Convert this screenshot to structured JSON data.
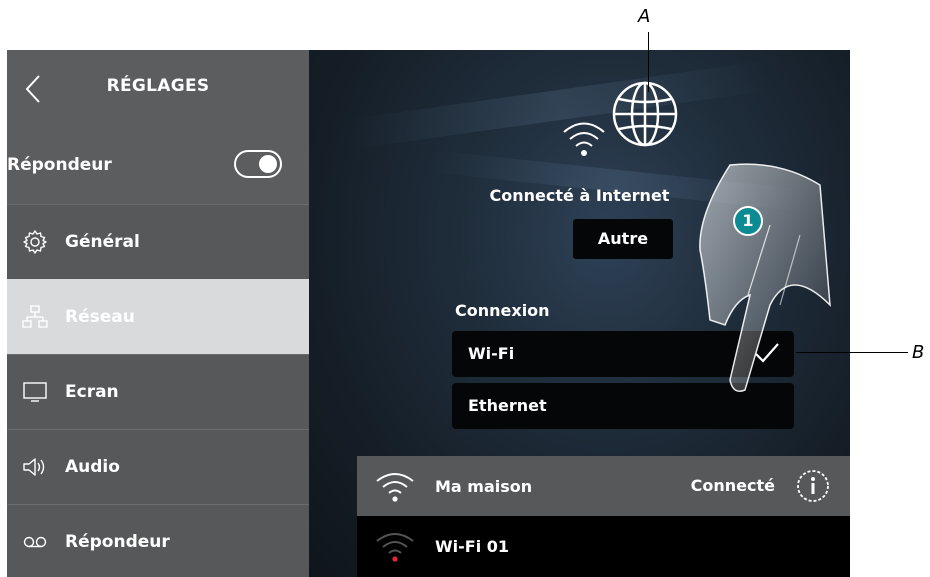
{
  "sidebar": {
    "title": "RÉGLAGES",
    "toggle_label": "Répondeur",
    "toggle_on": true,
    "items": [
      {
        "label": "Général",
        "icon": "gear-icon",
        "active": false
      },
      {
        "label": "Réseau",
        "icon": "network-icon",
        "active": true
      },
      {
        "label": "Ecran",
        "icon": "monitor-icon",
        "active": false
      },
      {
        "label": "Audio",
        "icon": "speaker-icon",
        "active": false
      },
      {
        "label": "Répondeur",
        "icon": "voicemail-icon",
        "active": false
      }
    ]
  },
  "main": {
    "status": "Connecté à Internet",
    "other_button": "Autre",
    "connection_label": "Connexion",
    "options": [
      {
        "label": "Wi-Fi",
        "selected": true
      },
      {
        "label": "Ethernet",
        "selected": false
      }
    ],
    "networks": [
      {
        "name": "Ma maison",
        "status": "Connecté"
      },
      {
        "name": "Wi-Fi 01",
        "status": ""
      }
    ]
  },
  "annotations": {
    "callout_a": "A",
    "callout_b": "B",
    "step_badge": "1"
  },
  "colors": {
    "sidebar_bg": "#5c5d5f",
    "active_item_bg": "#d9dadb",
    "accent_badge": "#0d8b93",
    "signal_dot": "#e0283a"
  }
}
